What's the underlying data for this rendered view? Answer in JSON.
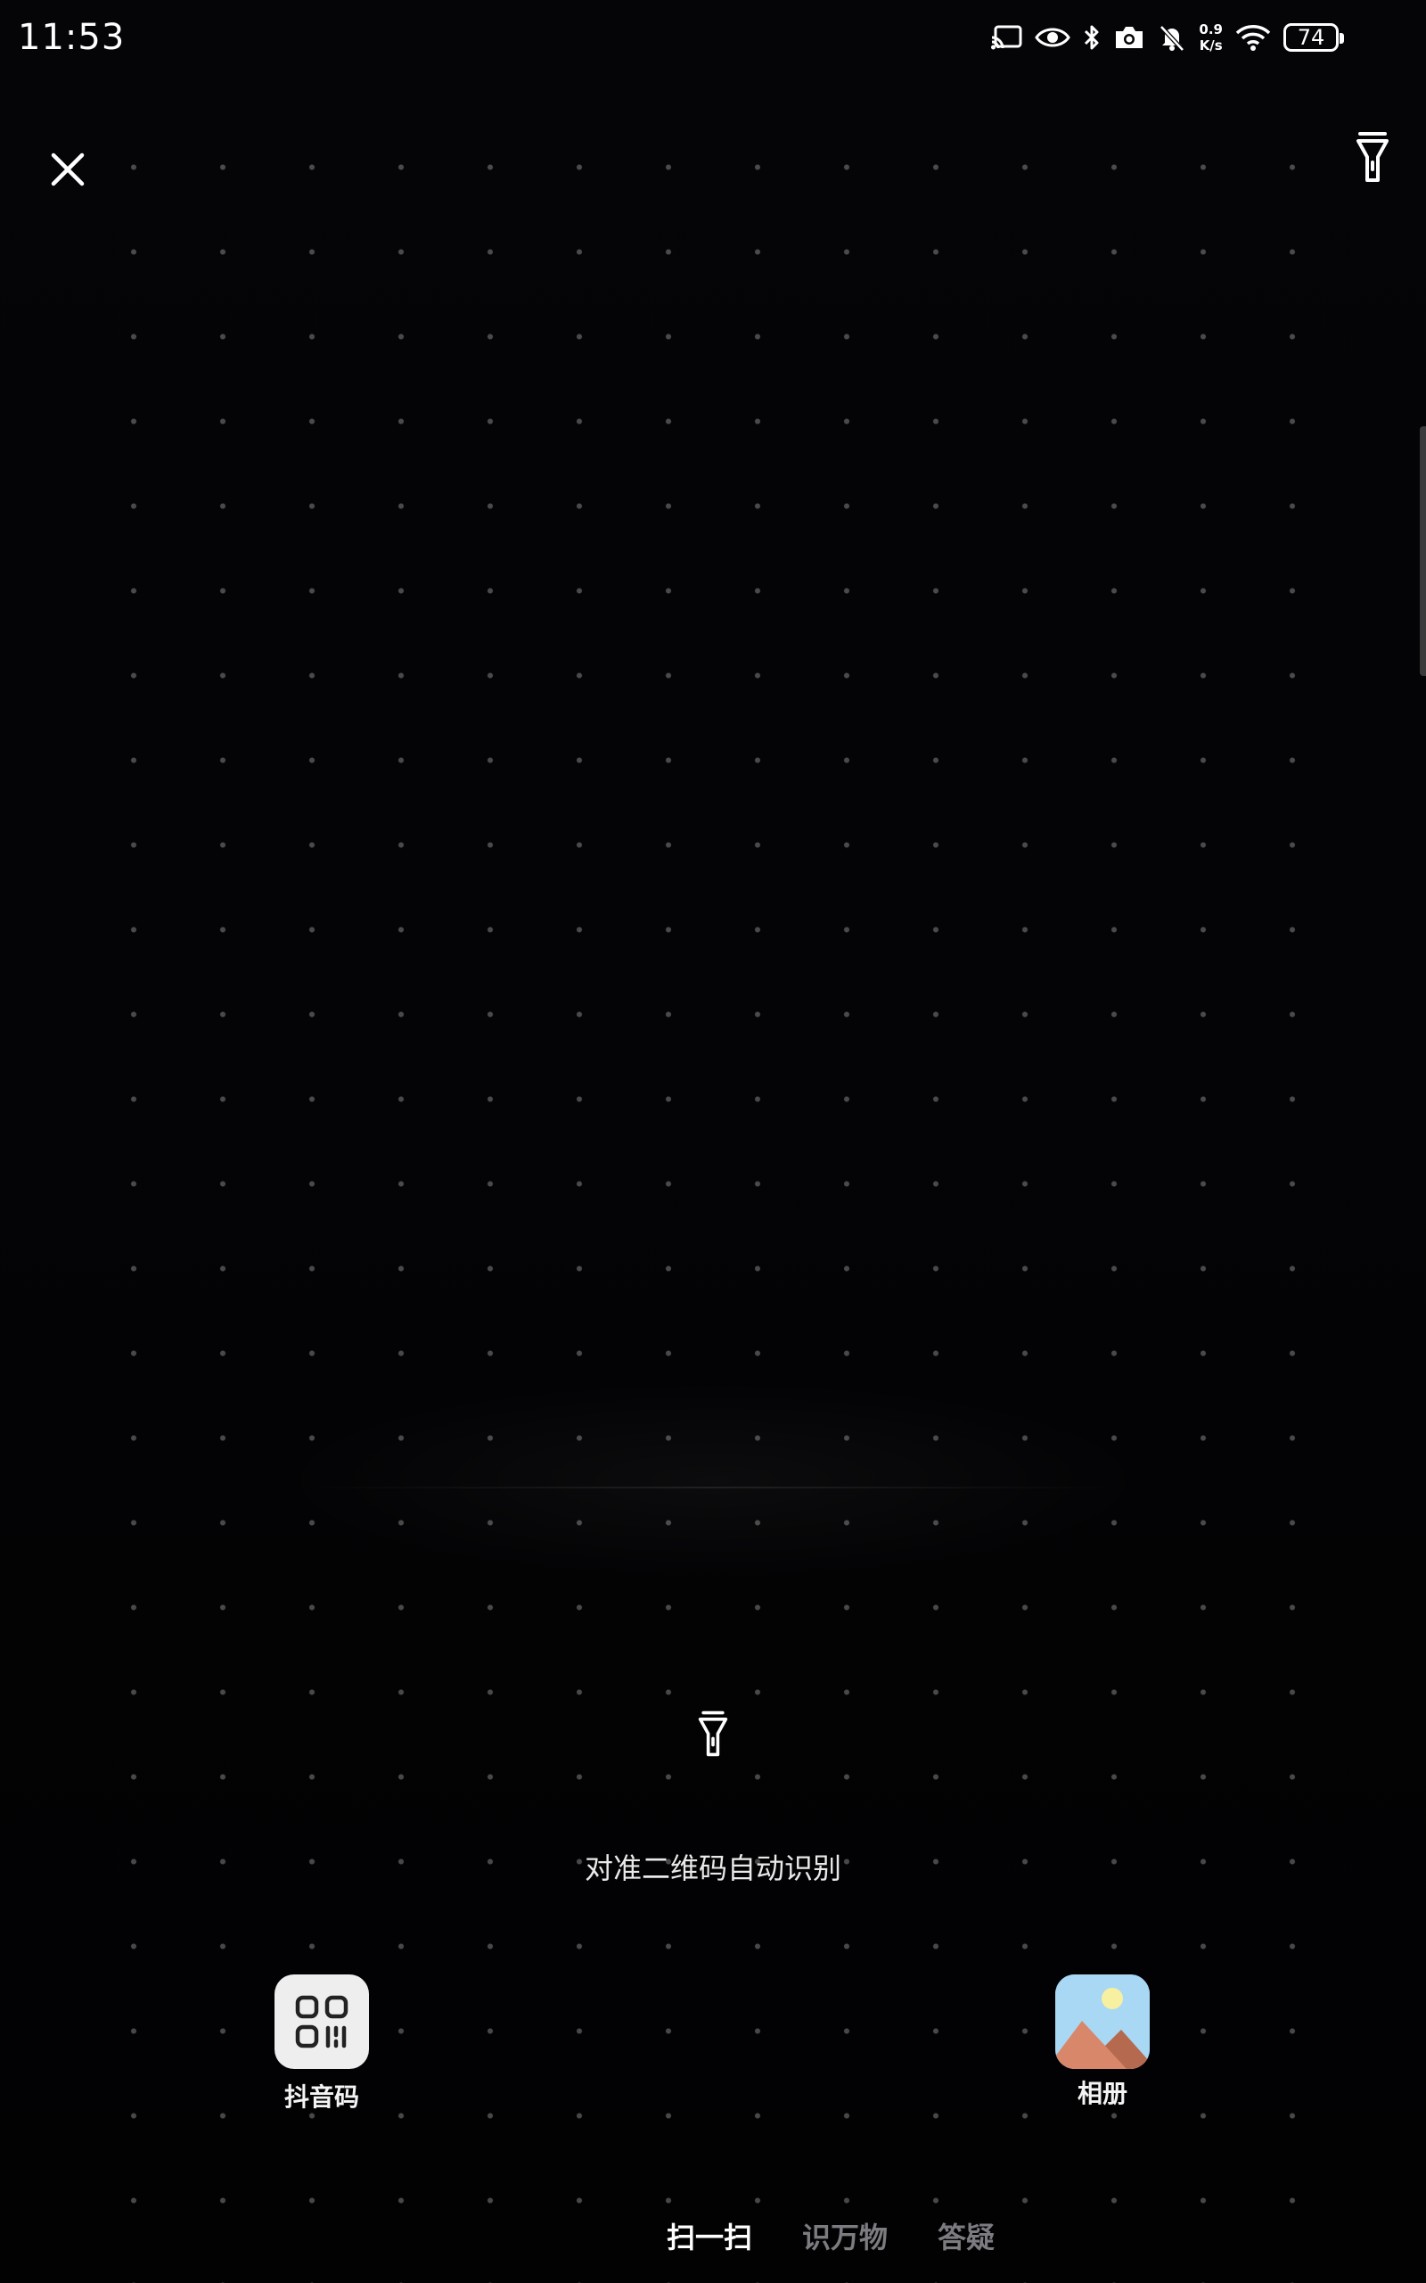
{
  "status_bar": {
    "time": "11:53",
    "net_speed_value": "0.9",
    "net_speed_unit": "K/s",
    "battery": "74",
    "icons": [
      "cast-icon",
      "eye-icon",
      "bluetooth-icon",
      "camera-icon",
      "bell-off-icon",
      "wifi-icon",
      "battery-icon"
    ]
  },
  "header": {
    "close_icon": "close-icon",
    "flashlight_icon": "flashlight-icon"
  },
  "scanner": {
    "flashlight_icon": "flashlight-icon",
    "hint": "对准二维码自动识别"
  },
  "quick_actions": [
    {
      "label": "抖音码",
      "icon": "qr-code-icon"
    },
    {
      "label": "相册",
      "icon": "photo-album-icon"
    }
  ],
  "mode_tabs": [
    {
      "label": "扫一扫",
      "active": true
    },
    {
      "label": "识万物",
      "active": false
    },
    {
      "label": "答疑",
      "active": false
    }
  ],
  "colors": {
    "background": "#040406",
    "active_tab": "#ffffff",
    "inactive_tab": "#7b7b80",
    "album_sky": "#a9d8f4",
    "album_sun": "#f7f0a0",
    "album_mountain": "#d9876a"
  }
}
